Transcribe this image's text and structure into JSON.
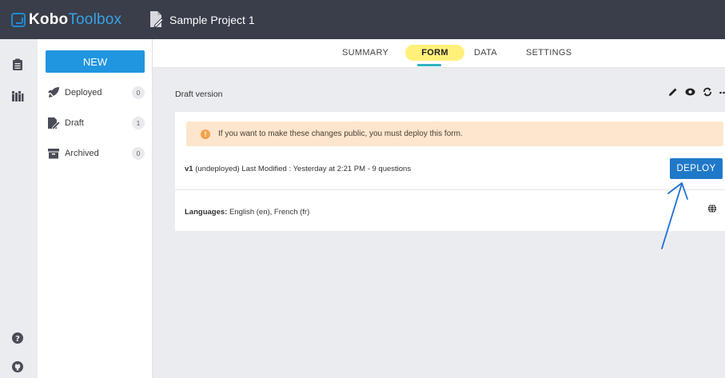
{
  "header": {
    "logo_bold": "Kobo",
    "logo_light": "Toolbox",
    "project_title": "Sample Project 1"
  },
  "rail": {
    "icons": [
      "form-list-icon",
      "library-icon",
      "help-icon",
      "github-icon"
    ]
  },
  "sidebar": {
    "new_label": "NEW",
    "items": [
      {
        "label": "Deployed",
        "count": "0",
        "icon": "rocket-icon"
      },
      {
        "label": "Draft",
        "count": "1",
        "icon": "draft-icon"
      },
      {
        "label": "Archived",
        "count": "0",
        "icon": "archive-icon"
      }
    ]
  },
  "tabs": {
    "summary": "SUMMARY",
    "form": "FORM",
    "data": "DATA",
    "settings": "SETTINGS",
    "active": "FORM"
  },
  "main": {
    "draft_label": "Draft version",
    "toolbar_icons": [
      "edit-icon",
      "preview-icon",
      "replace-icon",
      "more-icon"
    ],
    "notice": "If you want to make these changes public, you must deploy this form.",
    "version_tag": "v1",
    "version_status": "(undeployed)",
    "version_details": "Last Modified : Yesterday at 2:21 PM - 9 questions",
    "deploy_label": "DEPLOY",
    "languages_label": "Languages:",
    "languages_value": "English (en), French (fr)"
  },
  "colors": {
    "header_bg": "#3a3d4a",
    "brand_blue": "#2095e0",
    "deploy_blue": "#2079c8",
    "active_tab_highlight": "#fff07a",
    "tab_underline": "#30b2c3",
    "notice_bg": "#fde6cd",
    "annotation_arrow": "#1f6fd6"
  }
}
